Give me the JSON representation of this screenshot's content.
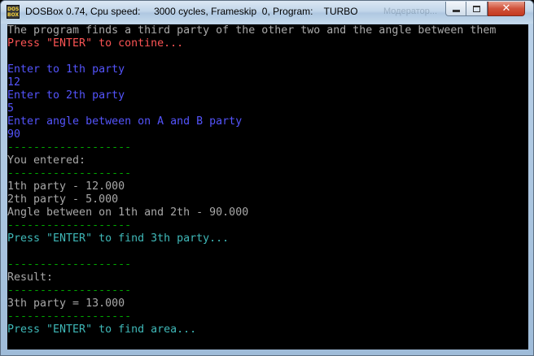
{
  "window": {
    "icon_text_top": "DOS",
    "icon_text_bottom": "BOX",
    "title": "DOSBox 0.74, Cpu speed:     3000 cycles, Frameskip  0, Program:    TURBO",
    "background_title": "Модератор..."
  },
  "controls": {
    "close_label": "✕"
  },
  "console": {
    "lines": [
      {
        "text": "The program finds a third party of the other two and the angle between them",
        "color": "gray"
      },
      {
        "text": "Press \"ENTER\" to contine...",
        "color": "red"
      },
      {
        "text": "",
        "color": "gray"
      },
      {
        "text": "Enter to 1th party",
        "color": "blue"
      },
      {
        "text": "12",
        "color": "blue"
      },
      {
        "text": "Enter to 2th party",
        "color": "blue"
      },
      {
        "text": "5",
        "color": "blue"
      },
      {
        "text": "Enter angle between on A and B party",
        "color": "blue"
      },
      {
        "text": "90",
        "color": "blue"
      },
      {
        "text": "-------------------",
        "color": "green"
      },
      {
        "text": "You entered:",
        "color": "gray"
      },
      {
        "text": "-------------------",
        "color": "green"
      },
      {
        "text": "1th party - 12.000",
        "color": "gray"
      },
      {
        "text": "2th party - 5.000",
        "color": "gray"
      },
      {
        "text": "Angle between on 1th and 2th - 90.000",
        "color": "gray"
      },
      {
        "text": "-------------------",
        "color": "green"
      },
      {
        "text": "Press \"ENTER\" to find 3th party...",
        "color": "cyan"
      },
      {
        "text": "",
        "color": "gray"
      },
      {
        "text": "-------------------",
        "color": "green"
      },
      {
        "text": "Result:",
        "color": "gray"
      },
      {
        "text": "-------------------",
        "color": "green"
      },
      {
        "text": "3th party = 13.000",
        "color": "gray"
      },
      {
        "text": "-------------------",
        "color": "green"
      },
      {
        "text": "Press \"ENTER\" to find area...",
        "color": "cyan"
      }
    ]
  },
  "colors": {
    "gray": "#a8a8a8",
    "red": "#fc5454",
    "blue": "#5454fc",
    "green": "#00a800",
    "cyan": "#3fb8b8"
  }
}
